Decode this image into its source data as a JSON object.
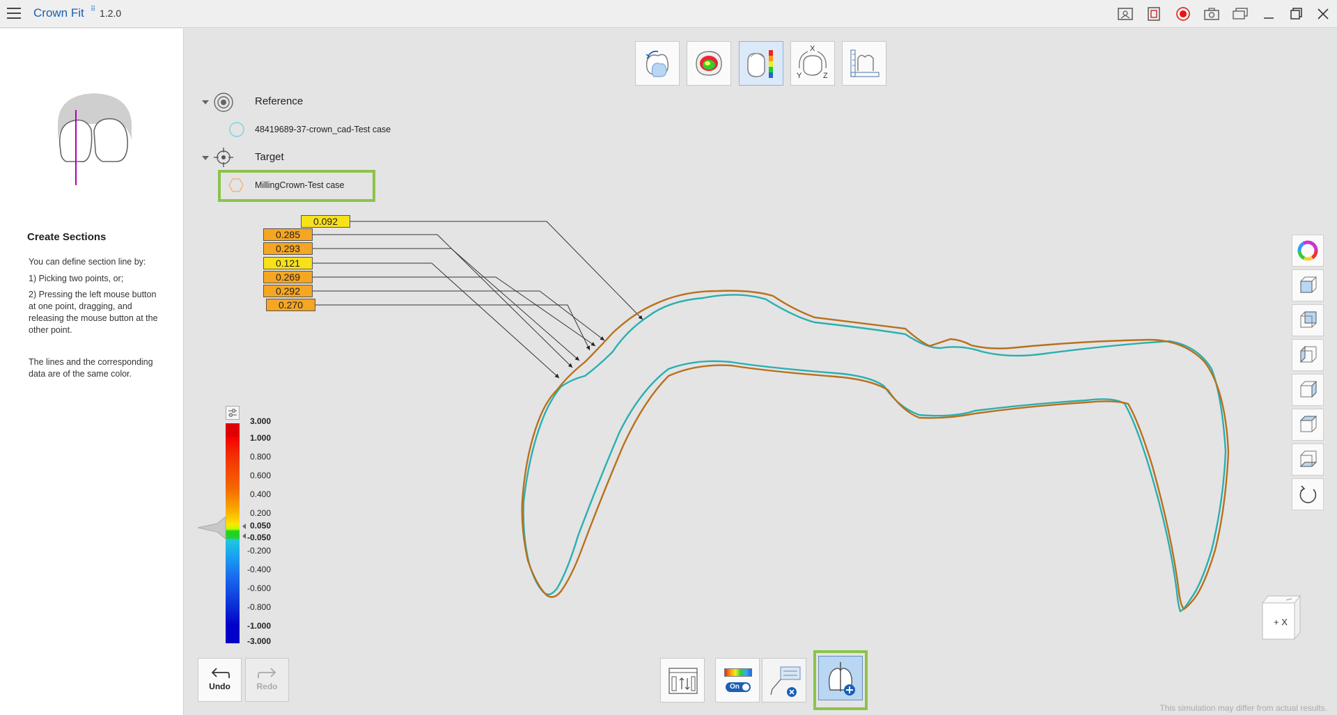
{
  "app": {
    "title": "Crown Fit",
    "version": "1.2.0"
  },
  "left_panel": {
    "title": "Create Sections",
    "intro": "You can define section line by:",
    "step1": "1) Picking two points, or;",
    "step2": "2) Pressing the left mouse button at one point, dragging, and releasing the mouse button at the other point.",
    "note": "The lines and the corresponding data are of the same color."
  },
  "tree": {
    "reference_label": "Reference",
    "reference_item": "48419689-37-crown_cad-Test case",
    "target_label": "Target",
    "target_item": "MillingCrown-Test case"
  },
  "measurements": [
    "0.092",
    "0.285",
    "0.293",
    "0.121",
    "0.269",
    "0.292",
    "0.270"
  ],
  "legend": {
    "values": [
      "3.000",
      "1.000",
      "0.800",
      "0.600",
      "0.400",
      "0.200",
      "0.050",
      "-0.050",
      "-0.200",
      "-0.400",
      "-0.600",
      "-0.800",
      "-1.000",
      "-3.000"
    ]
  },
  "undo": {
    "label": "Undo"
  },
  "redo": {
    "label": "Redo"
  },
  "toggle": {
    "label": "On"
  },
  "view_cube": {
    "label": "+ X"
  },
  "disclaimer": "This simulation may differ from actual results.",
  "colors": {
    "accent": "#1a5fb4",
    "reference_curve": "#2aafb0",
    "target_curve": "#b8701c",
    "highlight": "#8bc34a",
    "box_orange": "#f5a623",
    "box_yellow": "#f7e11a"
  }
}
